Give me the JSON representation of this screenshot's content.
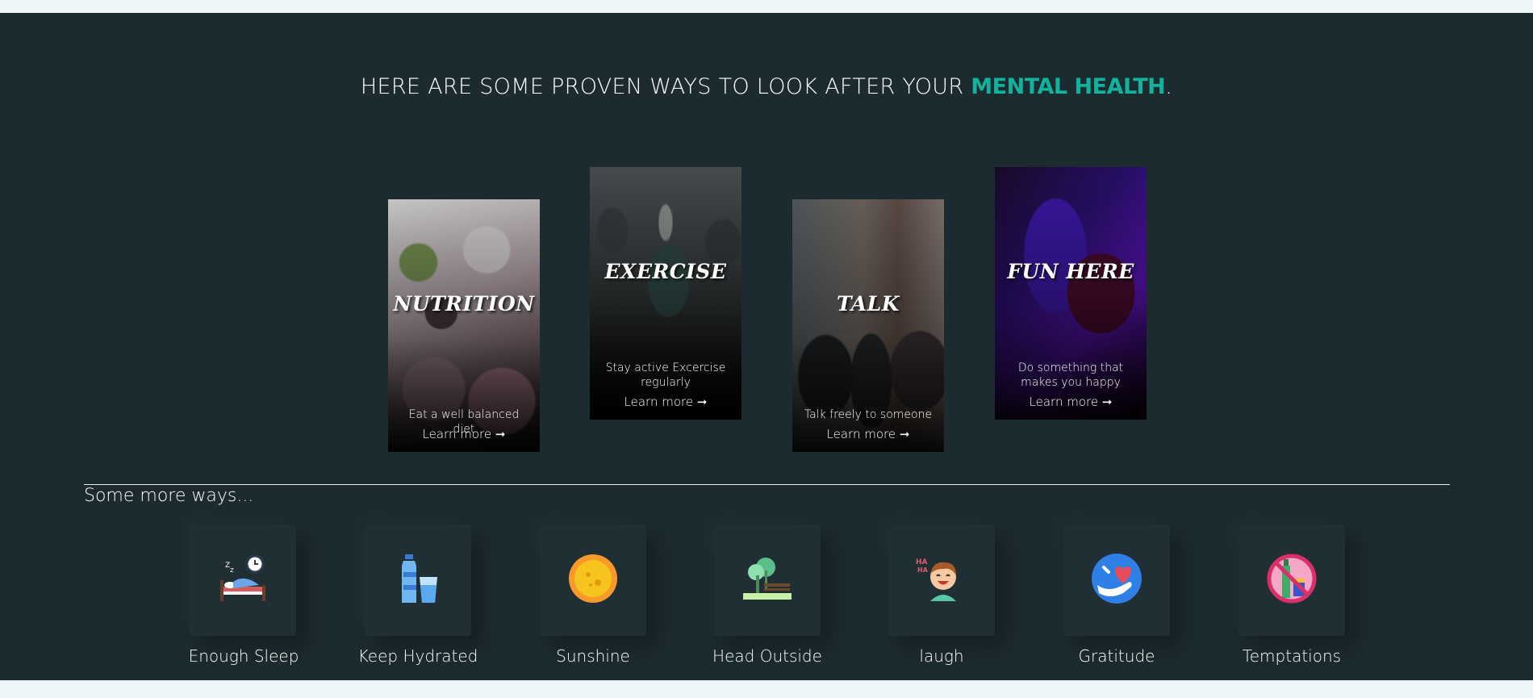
{
  "headline": {
    "text": "HERE ARE SOME PROVEN WAYS TO LOOK AFTER YOUR",
    "accent": "MENTAL HEALTH",
    "suffix": "."
  },
  "cards": [
    {
      "title": "NUTRITION",
      "description": "Eat a well balanced diet",
      "link": "Learn more ➞"
    },
    {
      "title": "EXERCISE",
      "description": "Stay active Excercise regularly",
      "link": "Learn more ➞"
    },
    {
      "title": "TALK",
      "description": "Talk freely to someone",
      "link": "Learn more ➞"
    },
    {
      "title": "FUN HERE",
      "description": "Do something that makes you happy",
      "link": "Learn more ➞"
    }
  ],
  "more": {
    "title": "Some more ways...",
    "items": [
      {
        "label": "Enough Sleep",
        "icon": "sleep-icon"
      },
      {
        "label": "Keep Hydrated",
        "icon": "water-bottle-icon"
      },
      {
        "label": "Sunshine",
        "icon": "sun-icon"
      },
      {
        "label": "Head Outside",
        "icon": "park-icon"
      },
      {
        "label": "laugh",
        "icon": "laughing-face-icon"
      },
      {
        "label": "Gratitude",
        "icon": "gratitude-icon"
      },
      {
        "label": "Temptations",
        "icon": "no-alcohol-icon"
      }
    ]
  },
  "colors": {
    "background": "#1c2b2f",
    "accent": "#12b39a",
    "page": "#eef5f8"
  }
}
